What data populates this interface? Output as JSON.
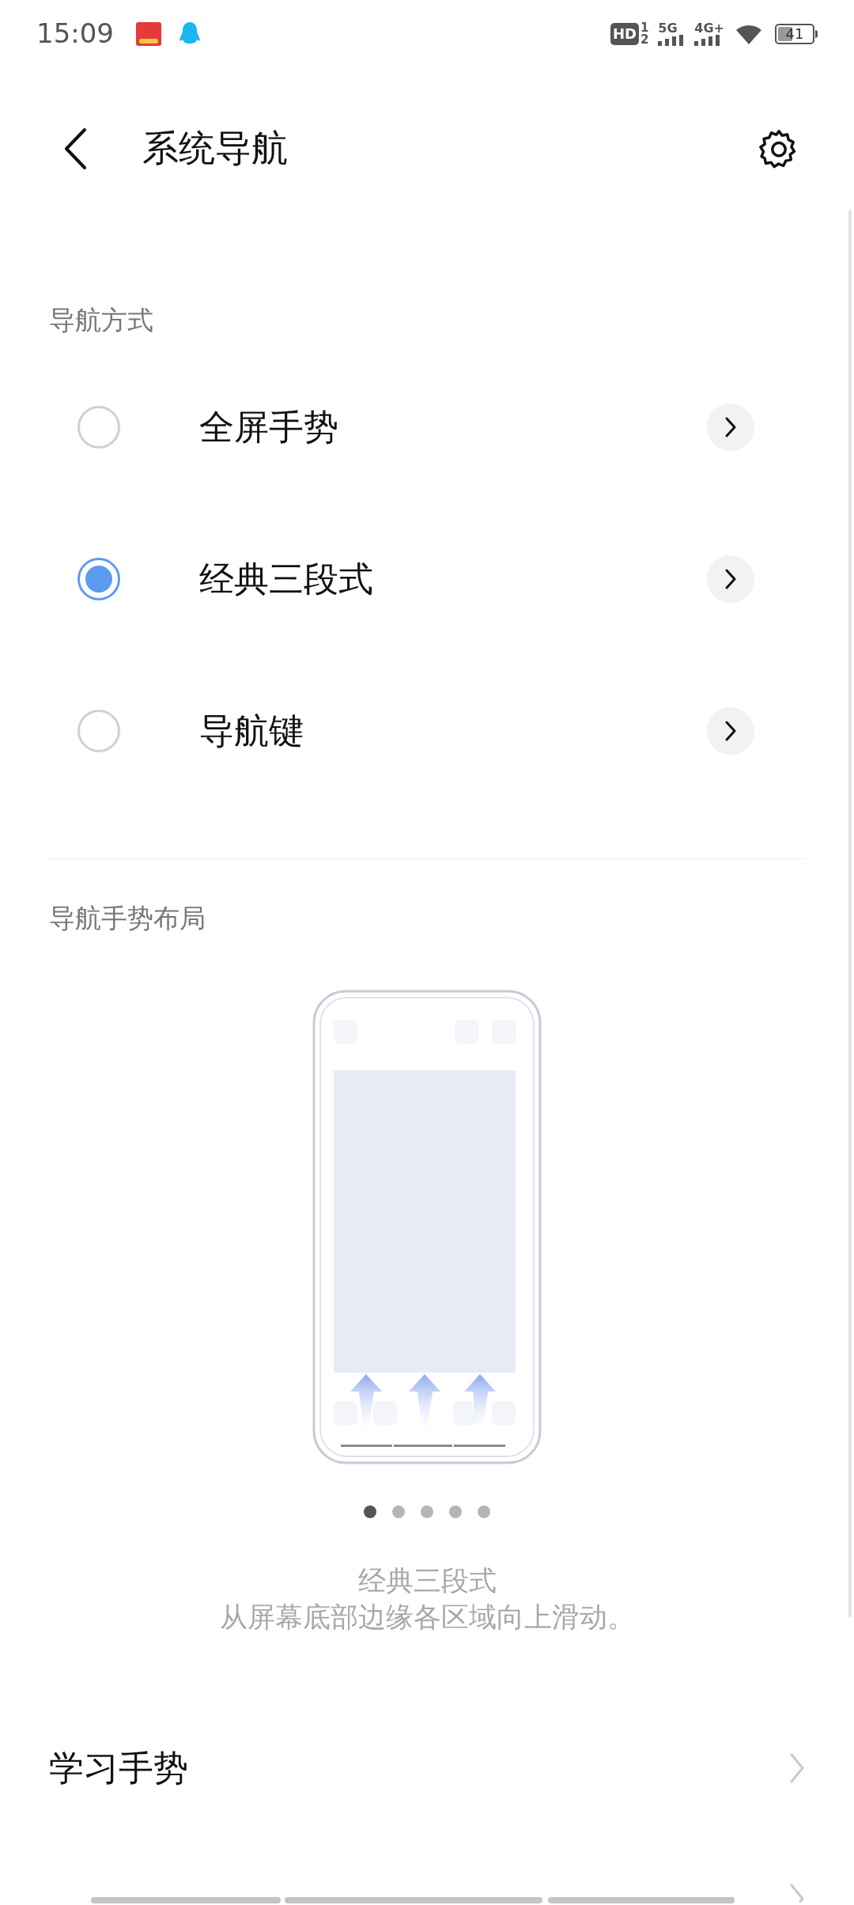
{
  "status_bar": {
    "time": "15:09",
    "hd": "HD",
    "sim_slots": [
      "1",
      "2"
    ],
    "networks": [
      "5G",
      "4G+"
    ],
    "battery": "41"
  },
  "header": {
    "title": "系统导航"
  },
  "nav_mode": {
    "label": "导航方式",
    "options": [
      {
        "label": "全屏手势",
        "selected": false
      },
      {
        "label": "经典三段式",
        "selected": true
      },
      {
        "label": "导航键",
        "selected": false
      }
    ]
  },
  "gesture_layout": {
    "label": "导航手势布局",
    "pages": [
      {
        "selected": true
      },
      {
        "selected": false
      },
      {
        "selected": false
      },
      {
        "selected": false
      },
      {
        "selected": false
      }
    ],
    "caption_title": "经典三段式",
    "caption_text": "从屏幕底部边缘各区域向上滑动。"
  },
  "items": [
    {
      "label": "学习手势"
    }
  ]
}
